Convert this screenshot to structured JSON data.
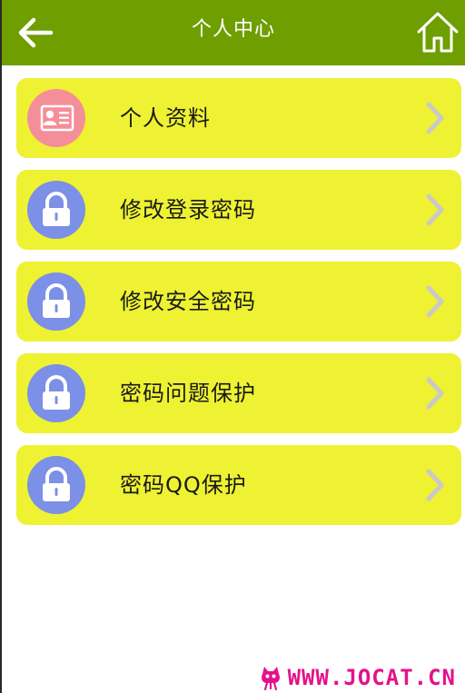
{
  "header": {
    "title": "个人中心",
    "back_icon": "arrow-left-icon",
    "home_icon": "home-icon"
  },
  "menu": {
    "items": [
      {
        "label": "个人资料",
        "icon": "profile-card-icon",
        "icon_color": "#f48f99"
      },
      {
        "label": "修改登录密码",
        "icon": "lock-icon",
        "icon_color": "#7b90e6"
      },
      {
        "label": "修改安全密码",
        "icon": "lock-icon",
        "icon_color": "#7b90e6"
      },
      {
        "label": "密码问题保护",
        "icon": "lock-icon",
        "icon_color": "#7b90e6"
      },
      {
        "label": "密码QQ保护",
        "icon": "lock-icon",
        "icon_color": "#7b90e6"
      }
    ]
  },
  "watermark": {
    "text": "WWW.JOCAT.CN",
    "icon": "cat-logo-icon"
  },
  "colors": {
    "header_bg": "#6f9e00",
    "item_bg": "#eef232",
    "arrow": "#c9c9c9",
    "watermark": "#e4128a"
  }
}
